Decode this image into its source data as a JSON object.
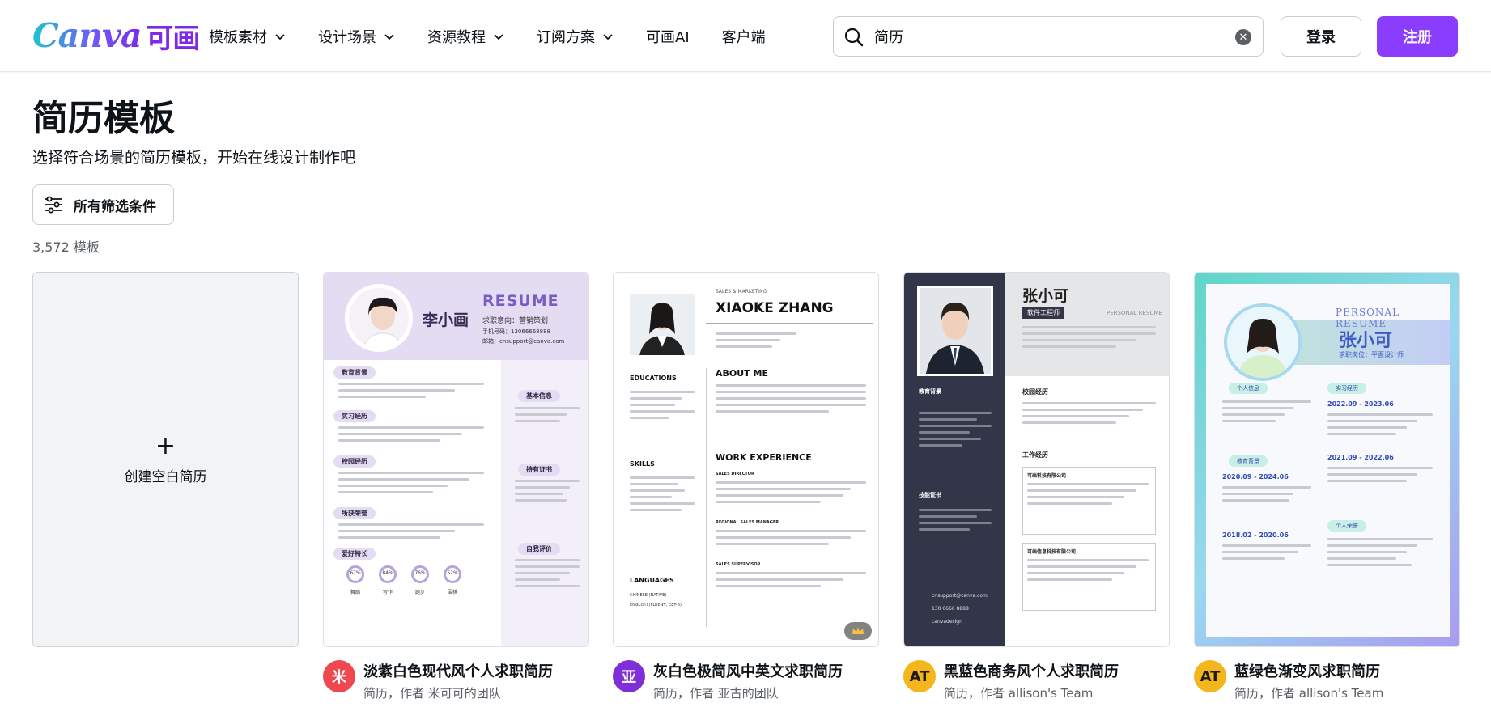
{
  "colors": {
    "brand_purple": "#8b3dff",
    "text": "#0e1318",
    "muted": "#5b6066",
    "border": "#c9ccd1"
  },
  "header": {
    "logo_word": "Canva",
    "logo_cn": "可画",
    "nav": [
      {
        "label": "模板素材",
        "dropdown": true
      },
      {
        "label": "设计场景",
        "dropdown": true
      },
      {
        "label": "资源教程",
        "dropdown": true
      },
      {
        "label": "订阅方案",
        "dropdown": true
      },
      {
        "label": "可画AI",
        "dropdown": false
      },
      {
        "label": "客户端",
        "dropdown": false
      }
    ],
    "search": {
      "value": "简历",
      "icon": "search-icon",
      "clear_icon": "clear-icon"
    },
    "login_label": "登录",
    "signup_label": "注册"
  },
  "main": {
    "title": "简历模板",
    "subtitle": "选择符合场景的简历模板，开始在线设计制作吧",
    "filters_label": "所有筛选条件",
    "count": "3,572 模板",
    "blank_card": {
      "plus": "+",
      "label": "创建空白简历"
    },
    "cards": [
      {
        "title": "淡紫白色现代风个人求职简历",
        "author": "简历，作者 米可可的团队",
        "avatar_text": "米",
        "avatar_color": "#ef4850",
        "preview": {
          "name": "李小画",
          "heading": "RESUME",
          "job": "求职意向：营销策划",
          "phone": "手机号码：13066668888",
          "email": "邮箱：cnsupport@canva.com",
          "sections": [
            "教育背景",
            "实习经历",
            "校园经历",
            "所获荣誉",
            "爱好特长"
          ],
          "side_sections": [
            "基本信息",
            "持有证书",
            "自我评价"
          ],
          "gauges": [
            "67%",
            "84%",
            "76%",
            "52%"
          ],
          "gauge_labels": [
            "舞蹈",
            "写作",
            "跑步",
            "围棋"
          ]
        }
      },
      {
        "title": "灰白色极简风中英文求职简历",
        "author": "简历，作者 亚古的团队",
        "avatar_text": "亚",
        "avatar_color": "#7e2fd8",
        "premium": true,
        "preview": {
          "role": "SALES & MARKETING",
          "name": "XIAOKE ZHANG",
          "about": "ABOUT ME",
          "work": "WORK EXPERIENCE",
          "left_headings": [
            "EDUCATIONS",
            "SKILLS",
            "LANGUAGES"
          ],
          "jobs": [
            "SALES DIRECTOR",
            "REGIONAL SALES MANAGER",
            "SALES SUPERVISOR"
          ],
          "languages": [
            "CHINESE (NATIVE)",
            "ENGLISH (FLUENT, CET-6)"
          ]
        }
      },
      {
        "title": "黑蓝色商务风个人求职简历",
        "author": "简历，作者 allison's Team",
        "avatar_text": "AT",
        "avatar_color": "#f5b51c",
        "preview": {
          "name": "张小可",
          "tag": "软件工程师",
          "tag_en": "PERSONAL RESUME",
          "left_sections": [
            "教育背景",
            "技能证书"
          ],
          "right_sections": [
            "校园经历",
            "工作经历"
          ],
          "companies": [
            "可画科技有限公司",
            "可画信息科技有限公司"
          ],
          "contacts": [
            "cnsupport@canva.com",
            "130 6666 8888",
            "canvadesign"
          ]
        }
      },
      {
        "title": "蓝绿色渐变风求职简历",
        "author": "简历，作者 allison's Team",
        "avatar_text": "AT",
        "avatar_color": "#f5b51c",
        "preview": {
          "heading": "PERSONAL RESUME",
          "name": "张小可",
          "job": "求职岗位：平面设计师",
          "pills_left": [
            "个人信息",
            "教育背景"
          ],
          "pills_right": [
            "实习经历",
            "个人荣誉"
          ],
          "dates": [
            "2022.09 - 2023.06",
            "2021.09 - 2022.06",
            "2020.09 - 2024.06",
            "2018.02 - 2020.06"
          ]
        }
      }
    ]
  }
}
